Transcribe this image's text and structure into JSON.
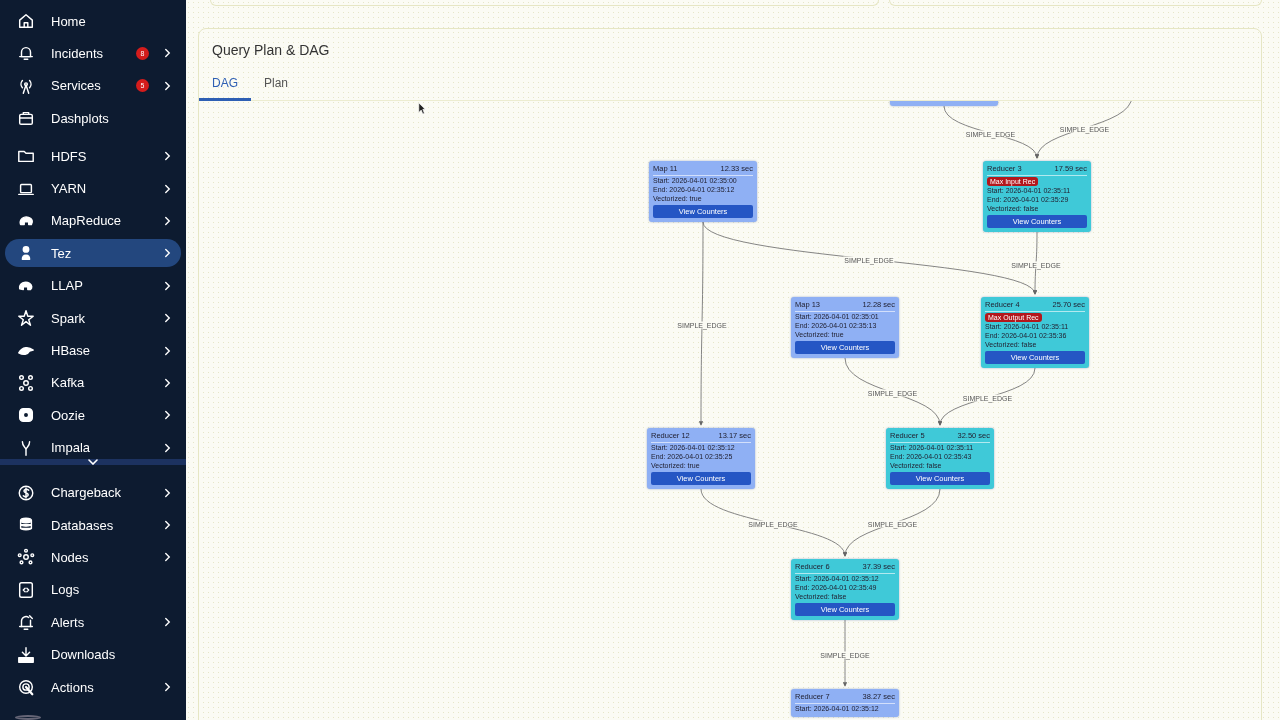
{
  "sidebar": {
    "sections": [
      [
        {
          "label": "Home",
          "has_submenu": false,
          "selected": false
        },
        {
          "label": "Incidents",
          "badge": "8",
          "has_submenu": true,
          "selected": false
        },
        {
          "label": "Services",
          "badge": "5",
          "has_submenu": true,
          "selected": false
        },
        {
          "label": "Dashplots",
          "has_submenu": false,
          "selected": false
        }
      ],
      [
        {
          "label": "HDFS",
          "has_submenu": true,
          "selected": false
        },
        {
          "label": "YARN",
          "has_submenu": true,
          "selected": false
        },
        {
          "label": "MapReduce",
          "has_submenu": true,
          "selected": false
        },
        {
          "label": "Tez",
          "has_submenu": true,
          "selected": true
        },
        {
          "label": "LLAP",
          "has_submenu": true,
          "selected": false
        },
        {
          "label": "Spark",
          "has_submenu": true,
          "selected": false
        },
        {
          "label": "HBase",
          "has_submenu": true,
          "selected": false
        },
        {
          "label": "Kafka",
          "has_submenu": true,
          "selected": false
        },
        {
          "label": "Oozie",
          "has_submenu": true,
          "selected": false
        },
        {
          "label": "Impala",
          "has_submenu": true,
          "selected": false
        }
      ],
      [
        {
          "label": "Chargeback",
          "has_submenu": true,
          "selected": false
        },
        {
          "label": "Databases",
          "has_submenu": true,
          "selected": false
        },
        {
          "label": "Nodes",
          "has_submenu": true,
          "selected": false
        },
        {
          "label": "Logs",
          "has_submenu": false,
          "selected": false
        },
        {
          "label": "Alerts",
          "has_submenu": true,
          "selected": false
        },
        {
          "label": "Downloads",
          "has_submenu": false,
          "selected": false
        },
        {
          "label": "Actions",
          "has_submenu": true,
          "selected": false
        }
      ]
    ]
  },
  "panel": {
    "title": "Query Plan & DAG",
    "tabs": [
      {
        "label": "DAG",
        "selected": true
      },
      {
        "label": "Plan",
        "selected": false
      }
    ],
    "dag": {
      "nodes": [
        {
          "clipped": true,
          "color": "#8fb0f4"
        },
        {
          "name": "Map 11",
          "duration": "12.33 sec",
          "lines": [
            "Start: 2026-04-01 02:35:00",
            "End: 2026-04-01 02:35:12",
            "Vectorized: true"
          ],
          "button": "View Counters",
          "color": "#8fb0f4"
        },
        {
          "name": "Reducer 3",
          "duration": "17.59 sec",
          "badge": "Max Input Rec",
          "lines": [
            "Start: 2026-04-01 02:35:11",
            "End: 2026-04-01 02:35:29",
            "Vectorized: false"
          ],
          "button": "View Counters",
          "color": "#3fc9d8"
        },
        {
          "name": "Map 13",
          "duration": "12.28 sec",
          "lines": [
            "Start: 2026-04-01 02:35:01",
            "End: 2026-04-01 02:35:13",
            "Vectorized: true"
          ],
          "button": "View Counters",
          "color": "#8fb0f4"
        },
        {
          "name": "Reducer 4",
          "duration": "25.70 sec",
          "badge": "Max Output Rec",
          "lines": [
            "Start: 2026-04-01 02:35:11",
            "End: 2026-04-01 02:35:36",
            "Vectorized: false"
          ],
          "button": "View Counters",
          "color": "#3fc9d8"
        },
        {
          "name": "Reducer 12",
          "duration": "13.17 sec",
          "lines": [
            "Start: 2026-04-01 02:35:12",
            "End: 2026-04-01 02:35:25",
            "Vectorized: true"
          ],
          "button": "View Counters",
          "color": "#8fb0f4"
        },
        {
          "name": "Reducer 5",
          "duration": "32.50 sec",
          "lines": [
            "Start: 2026-04-01 02:35:11",
            "End: 2026-04-01 02:35:43",
            "Vectorized: false"
          ],
          "button": "View Counters",
          "color": "#3fc9d8"
        },
        {
          "name": "Reducer 6",
          "duration": "37.39 sec",
          "lines": [
            "Start: 2026-04-01 02:35:12",
            "End: 2026-04-01 02:35:49",
            "Vectorized: false"
          ],
          "button": "View Counters",
          "color": "#3fc9d8"
        },
        {
          "name": "Reducer 7",
          "duration": "38.27 sec",
          "lines": [
            "Start: 2026-04-01 02:35:12"
          ],
          "color": "#8fb0f4"
        }
      ],
      "edges": [
        {
          "label": "SIMPLE_EDGE"
        },
        {
          "label": "SIMPLE_EDGE"
        },
        {
          "label": "SIMPLE_EDGE"
        },
        {
          "label": "SIMPLE_EDGE"
        },
        {
          "label": "SIMPLE_EDGE"
        },
        {
          "label": "SIMPLE_EDGE"
        },
        {
          "label": "SIMPLE_EDGE"
        },
        {
          "label": "SIMPLE_EDGE"
        },
        {
          "label": "SIMPLE_EDGE"
        },
        {
          "label": "SIMPLE_EDGE"
        }
      ]
    }
  }
}
